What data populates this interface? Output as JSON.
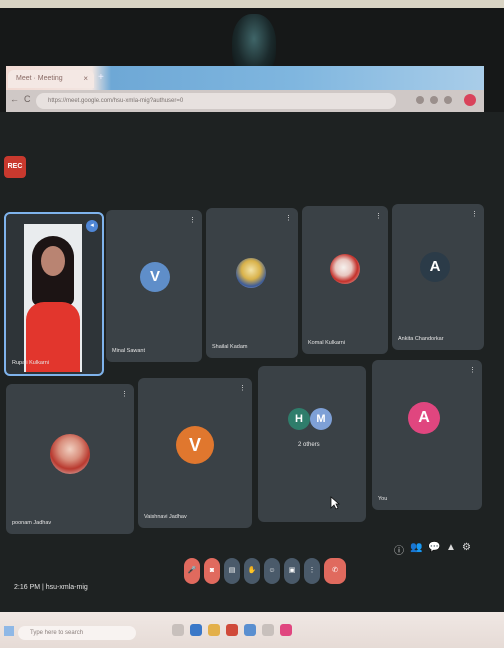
{
  "browser": {
    "tab_title": "Meet · Meeting",
    "tab_close": "×",
    "new_tab": "+",
    "url": "https://meet.google.com/hsu-xmla-mig?authuser=0",
    "back": "←",
    "forward": "→",
    "reload": "C"
  },
  "meet": {
    "rec_badge": "REC",
    "participants_top": [
      {
        "name": "Rupali Kulkarni",
        "kind": "self-video"
      },
      {
        "name": "Minal Sawant",
        "initial": "V",
        "color": "#5f8ec9"
      },
      {
        "name": "Shailal Kadam",
        "kind": "photo"
      },
      {
        "name": "Komal Kulkarni",
        "kind": "photo"
      },
      {
        "name": "Ankita Chandorkar",
        "initial": "A",
        "color": "#2b3b48"
      }
    ],
    "participants_bottom": [
      {
        "name": "poonam Jadhav",
        "kind": "photo"
      },
      {
        "name": "Vaishnavi Jadhav",
        "initial": "V",
        "color": "#e0772e"
      },
      {
        "name": "2 others",
        "initial_a": "H",
        "initial_b": "M",
        "color_a": "#2f7d6b",
        "color_b": "#7ea0d6"
      },
      {
        "name": "You",
        "initial": "A",
        "color": "#e0467f"
      }
    ],
    "tile_menu": "⋮",
    "pin_icon": "◂",
    "clock": "2:16 PM | hsu-xmla-mig",
    "controls": [
      {
        "label": "🎤",
        "color": "#e06a5e"
      },
      {
        "label": "◙",
        "color": "#e06a5e"
      },
      {
        "label": "▤",
        "color": "#4a5a6a"
      },
      {
        "label": "✋",
        "color": "#4a5a6a"
      },
      {
        "label": "☺",
        "color": "#4a5a6a"
      },
      {
        "label": "▣",
        "color": "#4a5a6a"
      },
      {
        "label": "⋮",
        "color": "#4a5a6a"
      },
      {
        "label": "✆",
        "color": "#e06a5e"
      }
    ],
    "right_controls": [
      "ⓘ",
      "👥",
      "💬",
      "▲",
      "⚙"
    ]
  },
  "taskbar": {
    "search_placeholder": "Type here to search"
  },
  "colors": {
    "meet_bg": "#1e2222",
    "tile_bg": "#3a4146",
    "self_border": "#7fb3ec"
  }
}
